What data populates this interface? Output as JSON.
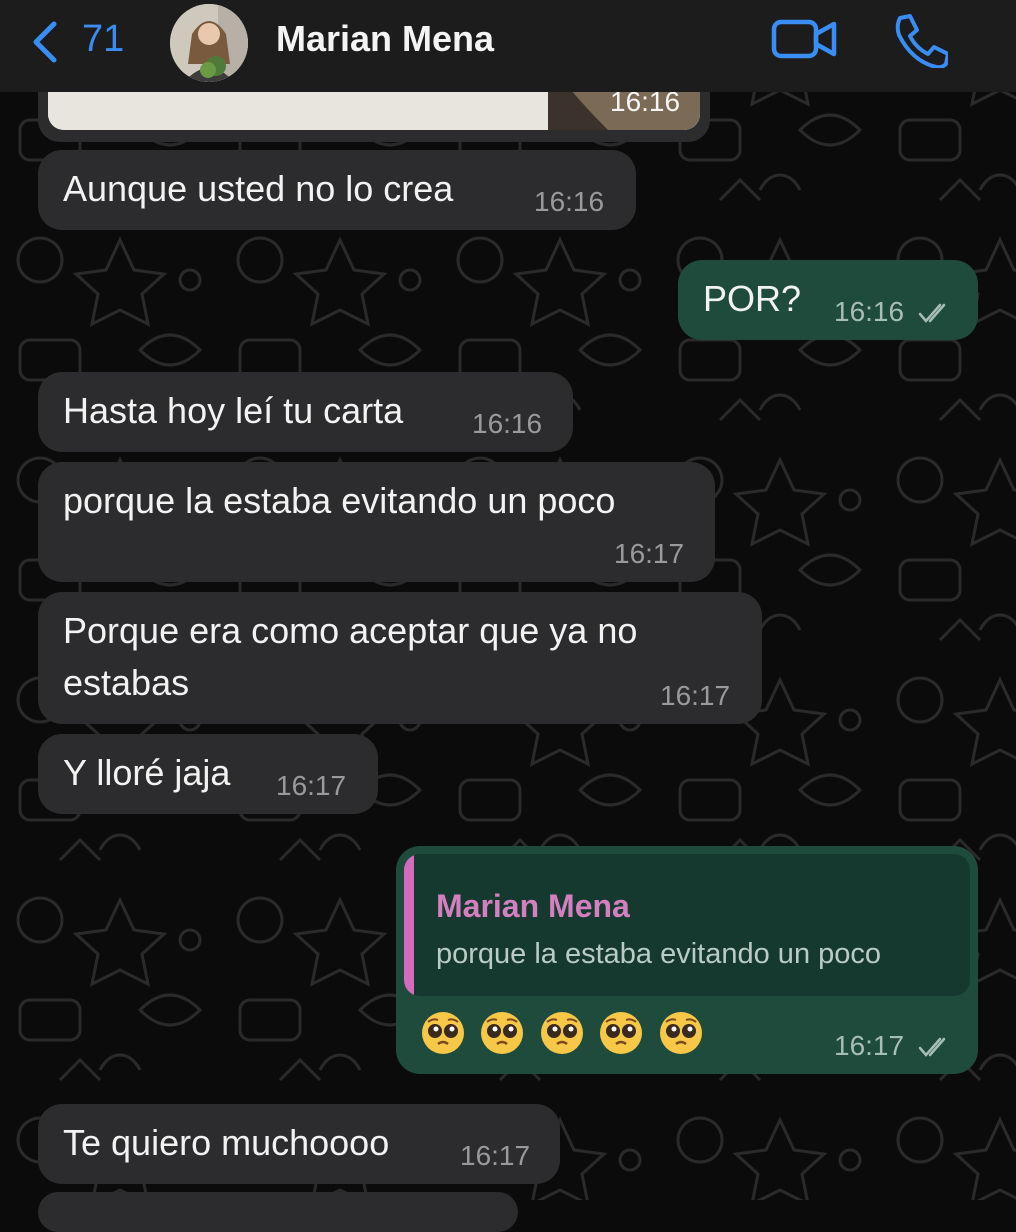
{
  "header": {
    "back_count": "71",
    "contact_name": "Marian Mena",
    "accent_color": "#3a8df5"
  },
  "chat": {
    "media_time": "16:16",
    "messages": [
      {
        "dir": "in",
        "text": "Aunque usted no lo crea",
        "time": "16:16"
      },
      {
        "dir": "out",
        "text": "POR?",
        "time": "16:16",
        "status": "read"
      },
      {
        "dir": "in",
        "text": "Hasta hoy leí tu carta",
        "time": "16:16"
      },
      {
        "dir": "in",
        "text": "porque la estaba evitando un poco",
        "time": "16:17"
      },
      {
        "dir": "in",
        "line1": "Porque era como aceptar que ya no",
        "line2": "estabas",
        "time": "16:17"
      },
      {
        "dir": "in",
        "text": "Y lloré jaja",
        "time": "16:17"
      },
      {
        "dir": "out",
        "reply_to": {
          "name": "Marian Mena",
          "text": "porque la estaba evitando un poco"
        },
        "emoji_count": 5,
        "emoji_icon": "pleading-face-icon",
        "time": "16:17",
        "status": "read"
      },
      {
        "dir": "in",
        "text": "Te quiero muchoooo",
        "time": "16:17"
      }
    ]
  },
  "colors": {
    "incoming_bubble": "#2c2c2e",
    "outgoing_bubble": "#1f4b3c",
    "quote_accent": "#d36cbc"
  }
}
